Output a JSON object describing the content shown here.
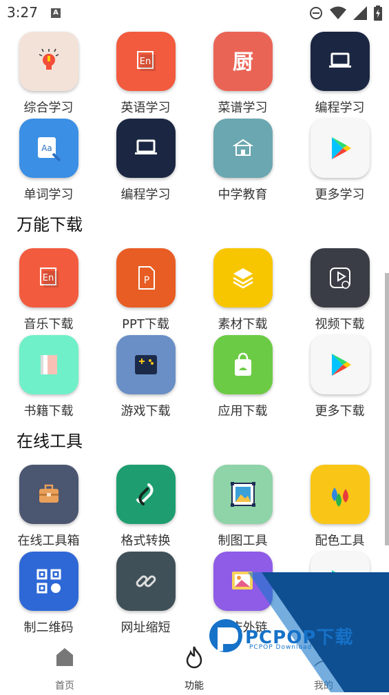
{
  "status": {
    "time": "3:27",
    "a_badge": "A"
  },
  "section_learn": {
    "rows": [
      [
        {
          "label": "综合学习",
          "color": "#F3E2D8",
          "icon": "lightbulb-icon"
        },
        {
          "label": "英语学习",
          "color": "#F25B3E",
          "icon": "english-icon",
          "glyph": "En"
        },
        {
          "label": "菜谱学习",
          "color": "#EA6456",
          "icon": "kitchen-icon",
          "glyph": "厨"
        },
        {
          "label": "编程学习",
          "color": "#1B2742",
          "icon": "laptop-icon"
        }
      ],
      [
        {
          "label": "单词学习",
          "color": "#3B8FE4",
          "icon": "dictionary-icon",
          "glyph": "Aa"
        },
        {
          "label": "编程学习",
          "color": "#1B2742",
          "icon": "laptop-icon"
        },
        {
          "label": "中学教育",
          "color": "#6BA7B0",
          "icon": "school-icon"
        },
        {
          "label": "更多学习",
          "color": "#F7F7F7",
          "icon": "play-store-icon"
        }
      ]
    ]
  },
  "section_download": {
    "title": "万能下载",
    "rows": [
      [
        {
          "label": "音乐下载",
          "color": "#F25B3E",
          "icon": "english-icon",
          "glyph": "En"
        },
        {
          "label": "PPT下载",
          "color": "#E85D24",
          "icon": "ppt-icon",
          "glyph": "P"
        },
        {
          "label": "素材下载",
          "color": "#F7C600",
          "icon": "layers-icon"
        },
        {
          "label": "视频下载",
          "color": "#3A3D45",
          "icon": "video-download-icon"
        }
      ],
      [
        {
          "label": "书籍下载",
          "color": "#6FF0C8",
          "icon": "book-icon"
        },
        {
          "label": "游戏下载",
          "color": "#6A8FC6",
          "icon": "gamepad-icon"
        },
        {
          "label": "应用下载",
          "color": "#6CCB45",
          "icon": "shopping-bag-icon"
        },
        {
          "label": "更多下载",
          "color": "#F7F7F7",
          "icon": "play-store-icon"
        }
      ]
    ]
  },
  "section_tools": {
    "title": "在线工具",
    "rows": [
      [
        {
          "label": "在线工具箱",
          "color": "#4B5670",
          "icon": "toolbox-icon"
        },
        {
          "label": "格式转换",
          "color": "#1E9E70",
          "icon": "convert-icon"
        },
        {
          "label": "制图工具",
          "color": "#8FD3A8",
          "icon": "image-frame-icon"
        },
        {
          "label": "配色工具",
          "color": "#F9C617",
          "icon": "color-drops-icon"
        }
      ],
      [
        {
          "label": "制二维码",
          "color": "#2E68D6",
          "icon": "qr-code-icon"
        },
        {
          "label": "网址缩短",
          "color": "#3F5058",
          "icon": "link-icon"
        },
        {
          "label": "图床外链",
          "color": "#8E5CE6",
          "icon": "image-upload-icon"
        },
        {
          "label": "",
          "color": "#F7F7F7",
          "icon": "play-store-icon"
        }
      ]
    ]
  },
  "navbar": {
    "home": "首页",
    "functions": "功能",
    "mine": "我的"
  },
  "watermark": {
    "brand": "PCPOP下载",
    "sub": "PCPOP Download"
  }
}
